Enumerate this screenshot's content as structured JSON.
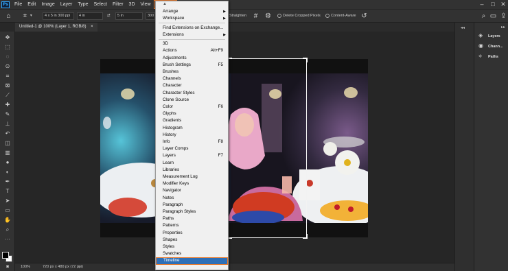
{
  "app": {
    "logo": "Ps"
  },
  "menubar": {
    "items": [
      "File",
      "Edit",
      "Image",
      "Layer",
      "Type",
      "Select",
      "Filter",
      "3D",
      "View",
      "Window"
    ],
    "active": "Window",
    "window_controls": [
      "–",
      "□",
      "✕"
    ]
  },
  "options": {
    "ratio_value": "4 x 5 in 300 ppi",
    "width_value": "4 in",
    "height_value": "5 in",
    "resolution_value": "300",
    "straighten_label": "Straighten",
    "delete_cropped_label": "Delete Cropped Pixels",
    "content_aware_label": "Content-Aware"
  },
  "document": {
    "tab_title": "Untitled-1 @ 100% (Layer 1, RGB/8)",
    "tab_close": "×"
  },
  "status": {
    "zoom": "100%",
    "doc_info": "720 px x 480 px (72 ppi)"
  },
  "panels": {
    "items": [
      {
        "icon": "layers-icon",
        "label": "Layers"
      },
      {
        "icon": "channels-icon",
        "label": "Chann..."
      },
      {
        "icon": "paths-icon",
        "label": "Paths"
      }
    ]
  },
  "window_menu": {
    "top_arrow": "▲",
    "items": [
      {
        "label": "Arrange",
        "submenu": true
      },
      {
        "label": "Workspace",
        "submenu": true
      },
      {
        "sep": true
      },
      {
        "label": "Find Extensions on Exchange..."
      },
      {
        "label": "Extensions",
        "submenu": true
      },
      {
        "sep": true
      },
      {
        "label": "3D"
      },
      {
        "label": "Actions",
        "shortcut": "Alt+F9"
      },
      {
        "label": "Adjustments"
      },
      {
        "label": "Brush Settings",
        "shortcut": "F5"
      },
      {
        "label": "Brushes"
      },
      {
        "label": "Channels"
      },
      {
        "label": "Character"
      },
      {
        "label": "Character Styles"
      },
      {
        "label": "Clone Source"
      },
      {
        "label": "Color",
        "shortcut": "F6"
      },
      {
        "label": "Glyphs"
      },
      {
        "label": "Gradients"
      },
      {
        "label": "Histogram"
      },
      {
        "label": "History"
      },
      {
        "label": "Info",
        "shortcut": "F8"
      },
      {
        "label": "Layer Comps"
      },
      {
        "label": "Layers",
        "shortcut": "F7"
      },
      {
        "label": "Learn"
      },
      {
        "label": "Libraries"
      },
      {
        "label": "Measurement Log"
      },
      {
        "label": "Modifier Keys"
      },
      {
        "label": "Navigator"
      },
      {
        "label": "Notes"
      },
      {
        "label": "Paragraph"
      },
      {
        "label": "Paragraph Styles"
      },
      {
        "label": "Paths"
      },
      {
        "label": "Patterns"
      },
      {
        "label": "Properties"
      },
      {
        "label": "Shapes"
      },
      {
        "label": "Styles"
      },
      {
        "label": "Swatches"
      },
      {
        "label": "Timeline",
        "highlighted": true
      }
    ]
  },
  "colors": {
    "accent_highlight": "#e8792b",
    "menu_selection": "#2d6fb7",
    "ps_blue": "#31a8ff"
  }
}
